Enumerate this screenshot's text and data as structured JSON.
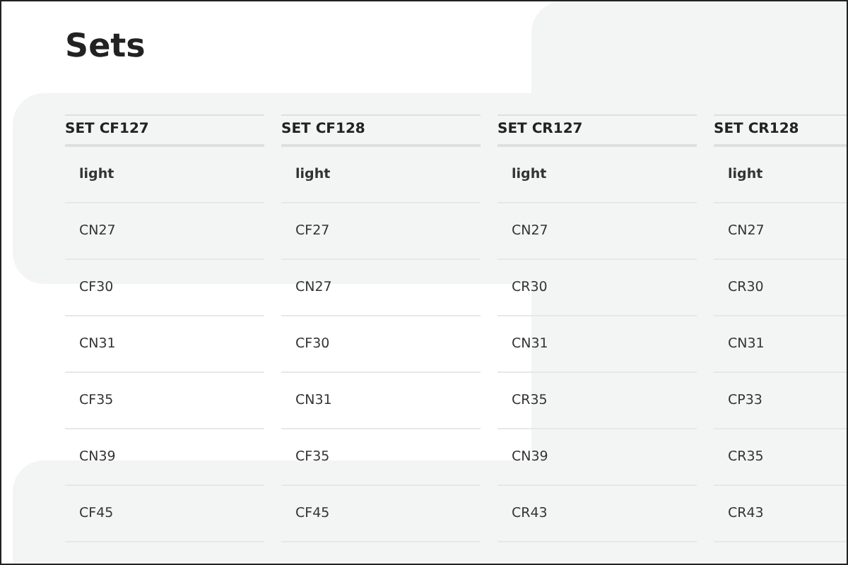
{
  "title": "Sets",
  "sets": [
    {
      "heading": "SET CF127",
      "subheading": "light",
      "items": [
        "CN27",
        "CF30",
        "CN31",
        "CF35",
        "CN39",
        "CF45"
      ]
    },
    {
      "heading": "SET CF128",
      "subheading": "light",
      "items": [
        "CF27",
        "CN27",
        "CF30",
        "CN31",
        "CF35",
        "CF45"
      ]
    },
    {
      "heading": "SET CR127",
      "subheading": "light",
      "items": [
        "CN27",
        "CR30",
        "CN31",
        "CR35",
        "CN39",
        "CR43"
      ]
    },
    {
      "heading": "SET CR128",
      "subheading": "light",
      "items": [
        "CN27",
        "CR30",
        "CN31",
        "CP33",
        "CR35",
        "CR43"
      ]
    }
  ]
}
